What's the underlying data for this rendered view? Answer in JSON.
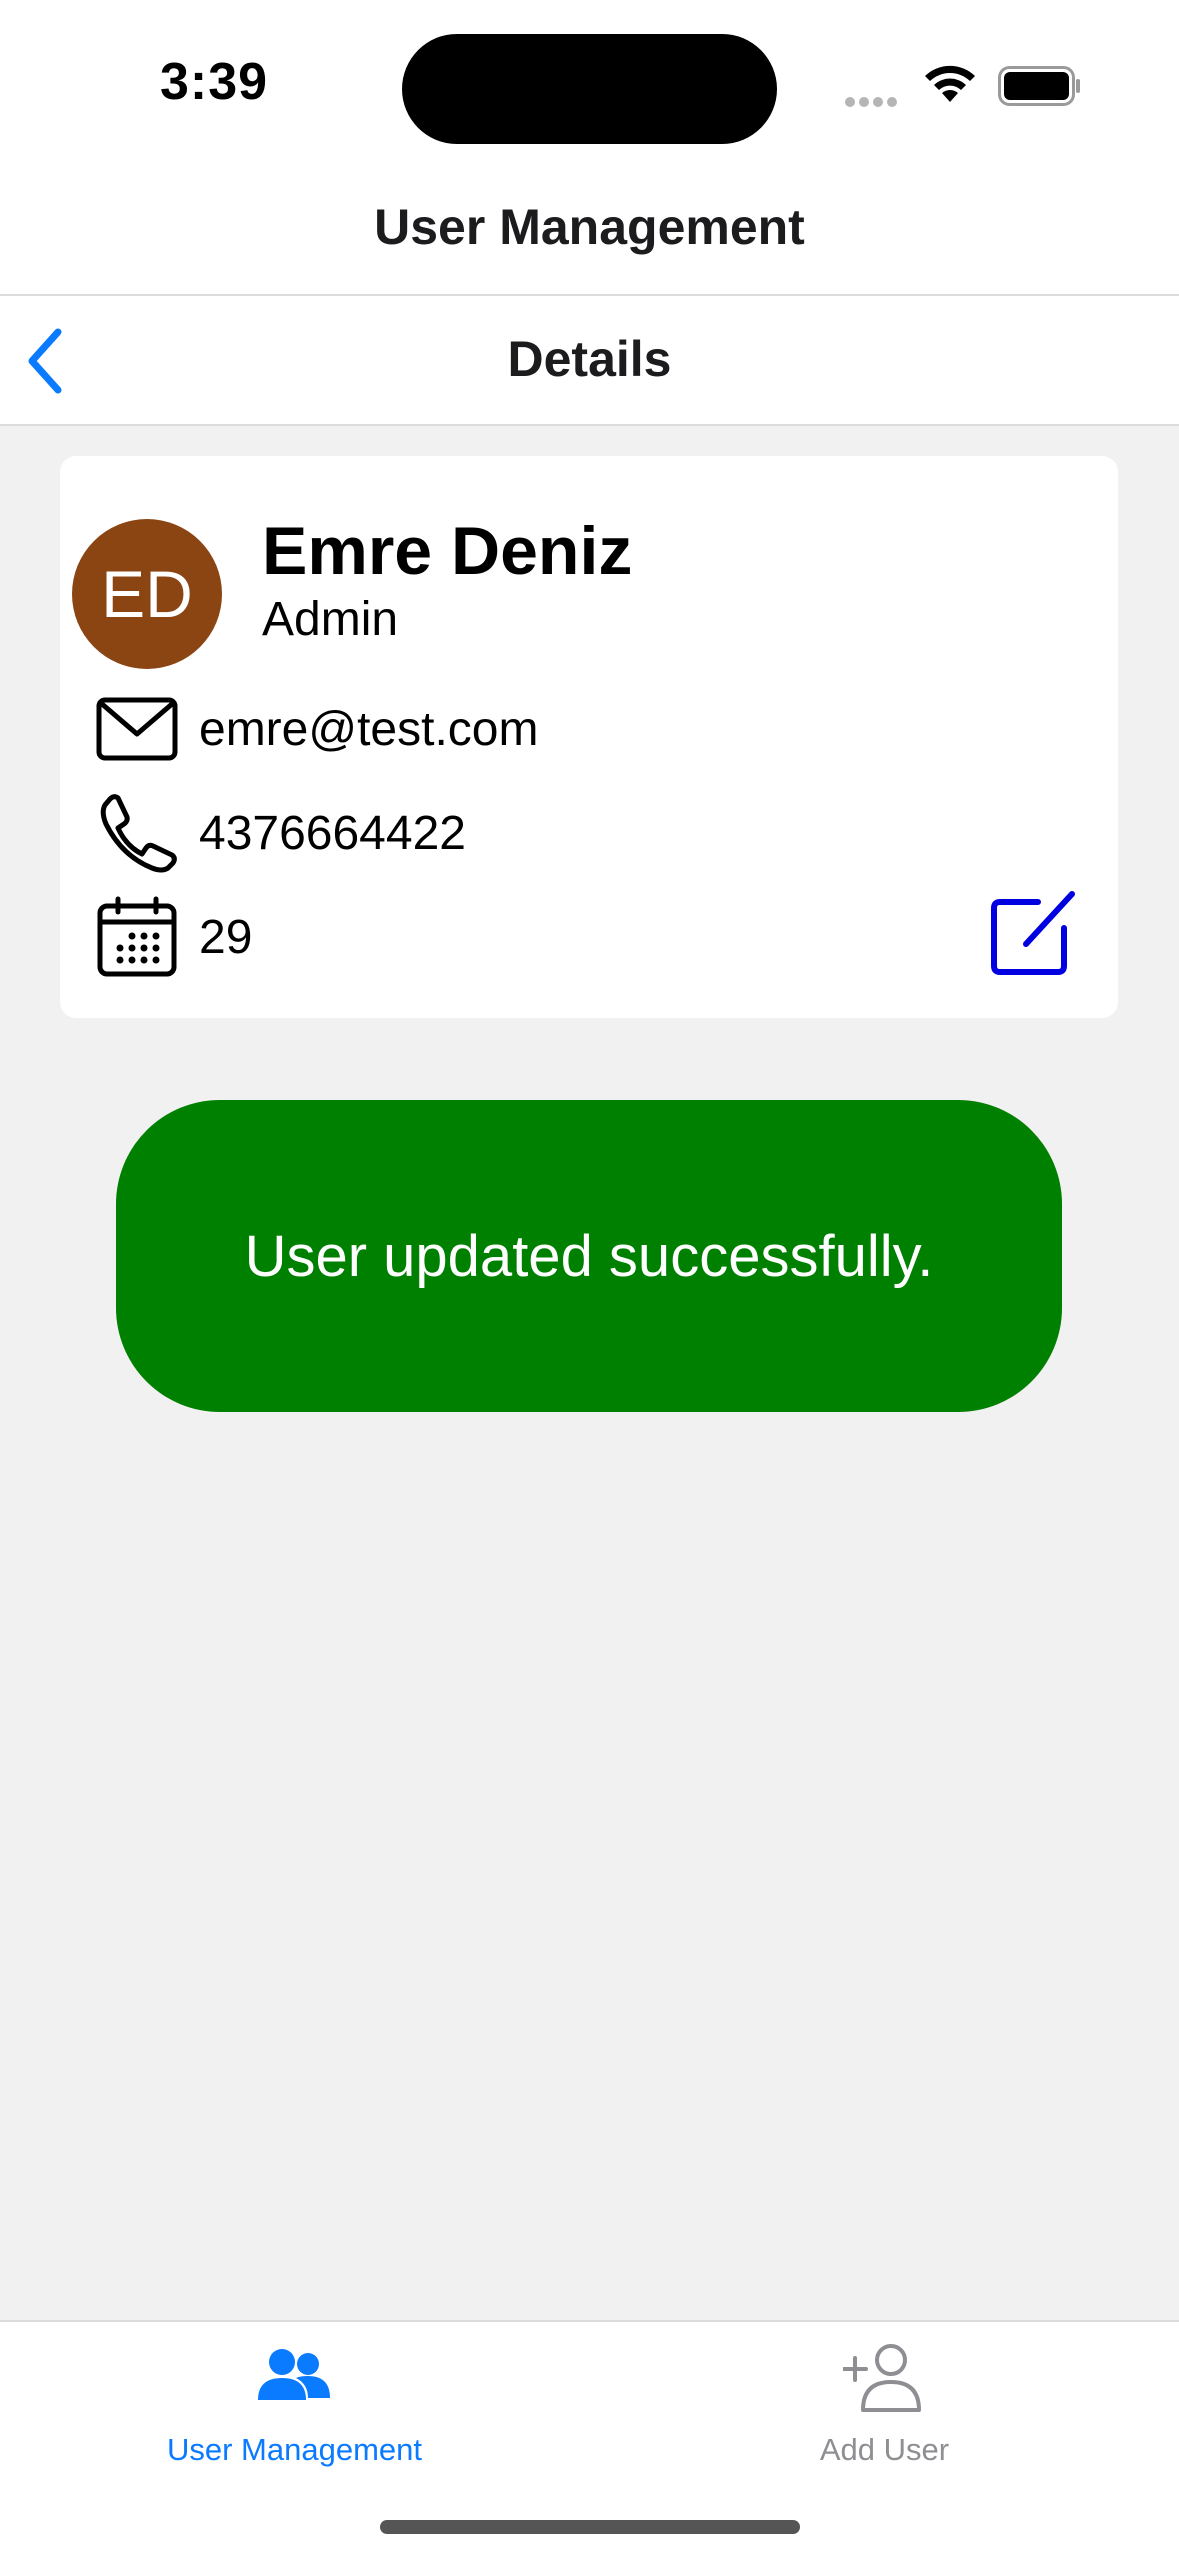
{
  "status_bar": {
    "time": "3:39"
  },
  "header": {
    "title": "User Management"
  },
  "nav": {
    "title": "Details"
  },
  "user": {
    "initials": "ED",
    "name": "Emre Deniz",
    "role": "Admin",
    "email": "emre@test.com",
    "phone": "4376664422",
    "age": "29"
  },
  "toast": {
    "message": "User updated successfully."
  },
  "tabs": [
    {
      "label": "User Management",
      "icon": "users-icon",
      "active": true
    },
    {
      "label": "Add User",
      "icon": "add-user-icon",
      "active": false
    }
  ],
  "colors": {
    "accent": "#0a7aff",
    "avatar": "#8b4513",
    "toast": "#008000",
    "edit": "#0000e0",
    "inactive_tab": "#8e8e93"
  }
}
